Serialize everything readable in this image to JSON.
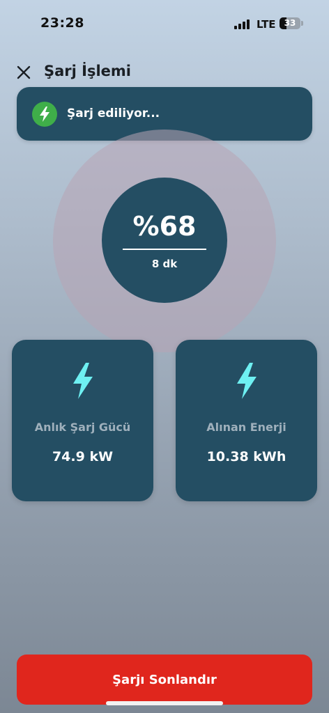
{
  "status_bar": {
    "time": "23:28",
    "network": "LTE",
    "battery_level": "33"
  },
  "header": {
    "title": "Şarj İşlemi",
    "close_icon": "close-icon"
  },
  "banner": {
    "icon": "lightning-bolt-icon",
    "text": "Şarj ediliyor..."
  },
  "progress": {
    "percent_text": "%68",
    "remaining_time": "8 dk"
  },
  "stats": [
    {
      "icon": "lightning-bolt-icon",
      "label": "Anlık Şarj Gücü",
      "value": "74.9 kW"
    },
    {
      "icon": "lightning-bolt-icon",
      "label": "Alınan Enerji",
      "value": "10.38 kWh"
    }
  ],
  "actions": {
    "end_button_label": "Şarjı Sonlandır"
  },
  "colors": {
    "card_bg": "#244e63",
    "accent_bolt": "#6ef0f2",
    "status_green": "#3fae49",
    "end_button": "#e0261d"
  }
}
